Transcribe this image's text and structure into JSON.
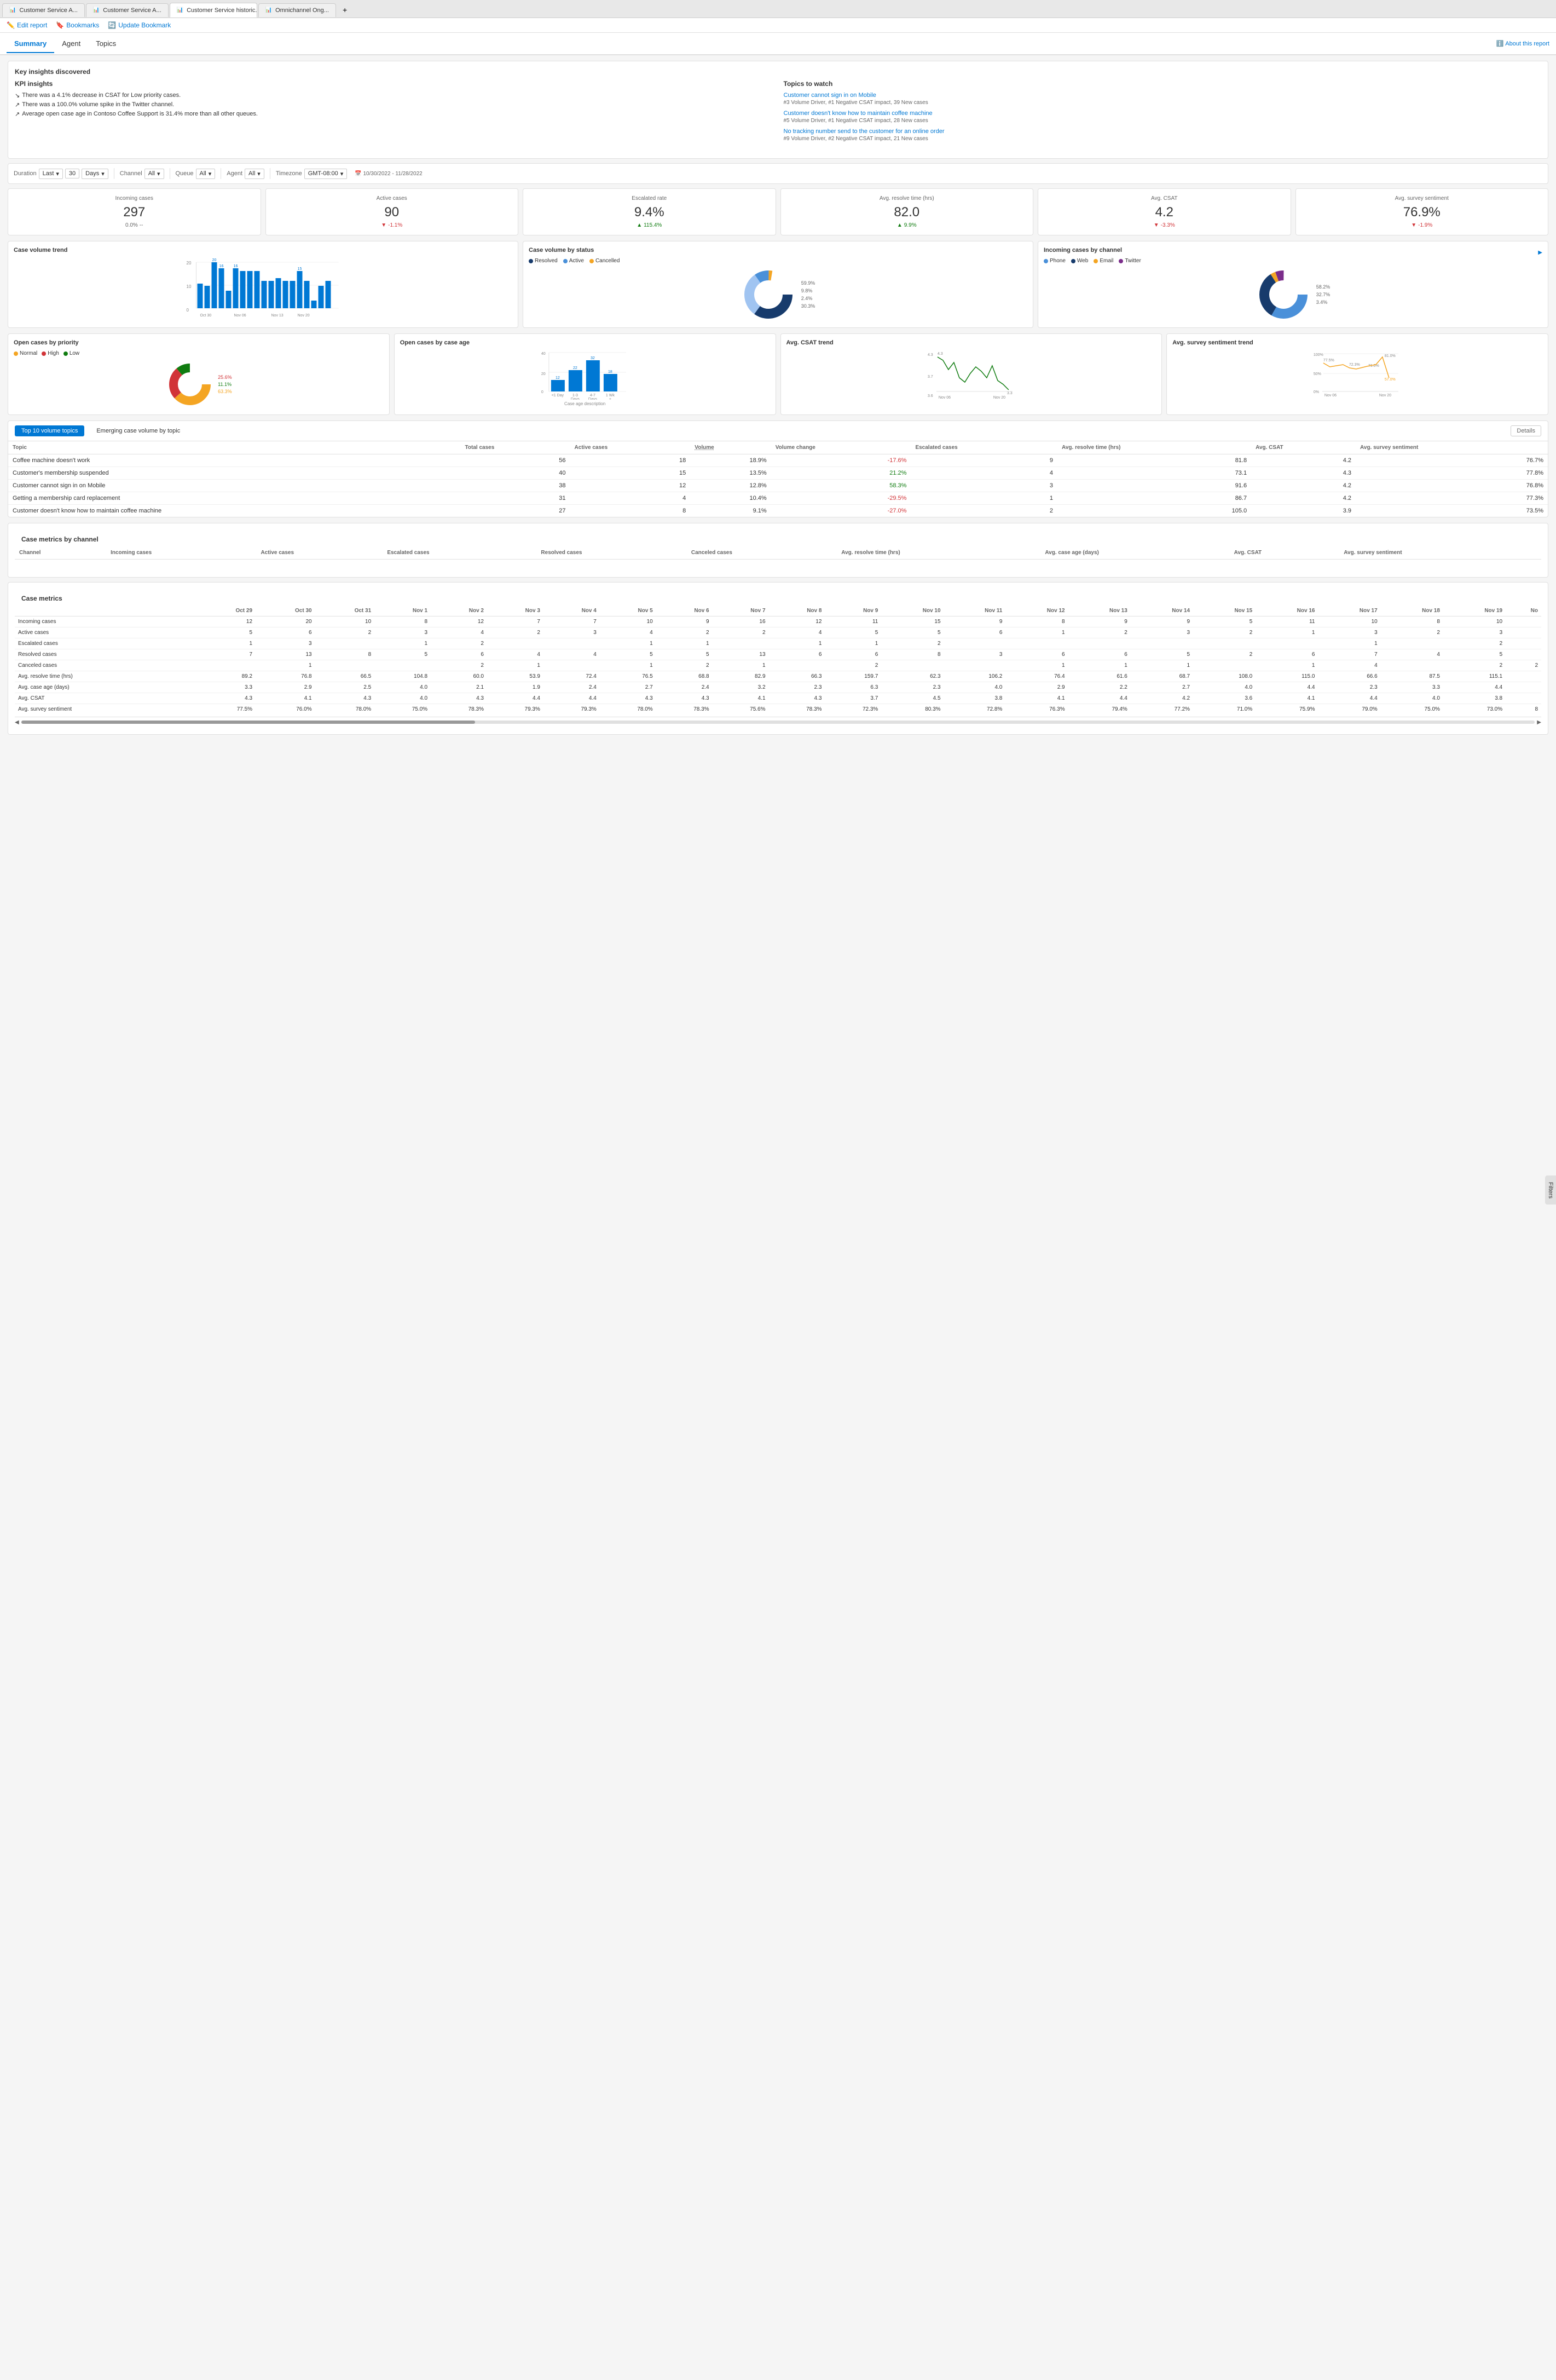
{
  "browser": {
    "tabs": [
      {
        "label": "Customer Service A...",
        "icon": "📊",
        "active": false
      },
      {
        "label": "Customer Service A...",
        "icon": "📊",
        "active": false
      },
      {
        "label": "Customer Service historic...",
        "icon": "📊",
        "active": true
      },
      {
        "label": "Omnichannel Ong...",
        "icon": "📊",
        "active": false
      }
    ]
  },
  "toolbar": {
    "edit_report": "Edit report",
    "bookmarks": "Bookmarks",
    "update_bookmark": "Update Bookmark"
  },
  "nav": {
    "tabs": [
      "Summary",
      "Agent",
      "Topics"
    ],
    "active": "Summary",
    "about_link": "About this report"
  },
  "insights": {
    "key_insights_title": "Key insights discovered",
    "kpi_title": "KPI insights",
    "kpi_items": [
      "There was a 4.1% decrease in CSAT for Low priority cases.",
      "There was a 100.0% volume spike in the Twitter channel.",
      "Average open case age in Contoso Coffee Support is 31.4% more than all other queues."
    ],
    "topics_title": "Topics to watch",
    "topics": [
      {
        "link": "Customer cannot sign in on Mobile",
        "meta": "#3 Volume Driver, #1 Negative CSAT impact, 39 New cases"
      },
      {
        "link": "Customer doesn't know how to maintain coffee machine",
        "meta": "#5 Volume Driver, #1 Negative CSAT impact, 28 New cases"
      },
      {
        "link": "No tracking number send to the customer for an online order",
        "meta": "#9 Volume Driver, #2 Negative CSAT impact, 21 New cases"
      }
    ]
  },
  "filters": {
    "duration_label": "Duration",
    "duration_type": "Last",
    "duration_value": "30",
    "duration_unit": "Days",
    "channel_label": "Channel",
    "channel_value": "All",
    "queue_label": "Queue",
    "queue_value": "All",
    "agent_label": "Agent",
    "agent_value": "All",
    "timezone_label": "Timezone",
    "timezone_value": "GMT-08:00",
    "date_range": "10/30/2022 - 11/28/2022"
  },
  "metrics": [
    {
      "label": "Incoming cases",
      "value": "297",
      "change": "0.0%",
      "change_dir": "neutral",
      "change2": "--"
    },
    {
      "label": "Active cases",
      "value": "90",
      "change": "-1.1%",
      "change_dir": "down"
    },
    {
      "label": "Escalated rate",
      "value": "9.4%",
      "change": "115.4%",
      "change_dir": "up"
    },
    {
      "label": "Avg. resolve time (hrs)",
      "value": "82.0",
      "change": "9.9%",
      "change_dir": "up"
    },
    {
      "label": "Avg. CSAT",
      "value": "4.2",
      "change": "-3.3%",
      "change_dir": "down"
    },
    {
      "label": "Avg. survey sentiment",
      "value": "76.9%",
      "change": "-1.9%",
      "change_dir": "down"
    }
  ],
  "case_volume_trend": {
    "title": "Case volume trend",
    "y_max": 20,
    "bars": [
      {
        "date": "Oct 30",
        "value": 12,
        "show_label": true
      },
      {
        "date": "",
        "value": 9,
        "show_label": false
      },
      {
        "date": "",
        "value": 20,
        "show_label": true,
        "highlight": true
      },
      {
        "date": "",
        "value": 16,
        "show_label": false
      },
      {
        "date": "",
        "value": 7,
        "show_label": false
      },
      {
        "date": "Nov 06",
        "value": 16,
        "show_label": true
      },
      {
        "date": "",
        "value": 14,
        "show_label": false
      },
      {
        "date": "",
        "value": 15,
        "show_label": false
      },
      {
        "date": "",
        "value": 15,
        "show_label": false
      },
      {
        "date": "",
        "value": 10,
        "show_label": false
      },
      {
        "date": "Nov 13",
        "value": 11,
        "show_label": false
      },
      {
        "date": "",
        "value": 12,
        "show_label": false
      },
      {
        "date": "",
        "value": 14,
        "show_label": false
      },
      {
        "date": "",
        "value": 13,
        "show_label": false
      },
      {
        "date": "",
        "value": 11,
        "show_label": false
      },
      {
        "date": "Nov 20",
        "value": 15,
        "show_label": true
      },
      {
        "date": "",
        "value": 10,
        "show_label": false
      },
      {
        "date": "",
        "value": 3,
        "show_label": false
      },
      {
        "date": "",
        "value": 9,
        "show_label": false
      },
      {
        "date": "",
        "value": 12,
        "show_label": false
      }
    ]
  },
  "case_volume_status": {
    "title": "Case volume by status",
    "legend": [
      {
        "label": "Resolved",
        "color": "#173b6c"
      },
      {
        "label": "Active",
        "color": "#4a90d9"
      },
      {
        "label": "Cancelled",
        "color": "#f4a523"
      }
    ],
    "segments": [
      {
        "label": "59.9%",
        "color": "#173b6c",
        "pct": 59.9
      },
      {
        "label": "9.8%",
        "color": "#4a90d9",
        "pct": 9.8
      },
      {
        "label": "2.4%",
        "color": "#f4a523",
        "pct": 2.4
      },
      {
        "label": "30.3%",
        "color": "#a0c4f1",
        "pct": 30.3
      }
    ]
  },
  "incoming_by_channel": {
    "title": "Incoming cases by channel",
    "legend": [
      {
        "label": "Phone",
        "color": "#4a90d9"
      },
      {
        "label": "Web",
        "color": "#173b6c"
      },
      {
        "label": "Email",
        "color": "#f4a523"
      },
      {
        "label": "Twitter",
        "color": "#7b2d8b"
      }
    ],
    "segments": [
      {
        "label": "58.2%",
        "color": "#4a90d9",
        "pct": 58.2
      },
      {
        "label": "32.7%",
        "color": "#173b6c",
        "pct": 32.7
      },
      {
        "label": "3.4%",
        "color": "#f4a523",
        "pct": 3.4
      },
      {
        "label": "5.7%",
        "color": "#7b2d8b",
        "pct": 5.7
      }
    ]
  },
  "open_cases_priority": {
    "title": "Open cases by priority",
    "legend": [
      {
        "label": "Normal",
        "color": "#f4a523"
      },
      {
        "label": "High",
        "color": "#d13438"
      },
      {
        "label": "Low",
        "color": "#107c10"
      }
    ],
    "segments": [
      {
        "pct": 63.3,
        "color": "#f4a523",
        "label": "63.3%"
      },
      {
        "pct": 25.6,
        "color": "#d13438",
        "label": "25.6%"
      },
      {
        "pct": 11.1,
        "color": "#107c10",
        "label": "11.1%"
      }
    ]
  },
  "open_cases_age": {
    "title": "Open cases by case age",
    "bars": [
      {
        "label": "<1 Day",
        "value": 12
      },
      {
        "label": "1-3 Days",
        "value": 22
      },
      {
        "label": "4-7 Days",
        "value": 32
      },
      {
        "label": "1 Week - 1 M...",
        "value": 18
      }
    ],
    "y_max": 40
  },
  "avg_csat_trend": {
    "title": "Avg. CSAT trend",
    "points": [
      4.3,
      4.2,
      3.9,
      4.1,
      3.7,
      3.6,
      3.8,
      4.0,
      3.9,
      3.7,
      4.1,
      3.5,
      3.6,
      3.3
    ],
    "labels": [
      "Nov 06",
      "Nov 20"
    ],
    "annotations": [
      "4.3",
      "3.7",
      "3.6",
      "3.3"
    ]
  },
  "avg_survey_trend": {
    "title": "Avg. survey sentiment trend",
    "points": [
      77.5,
      72.3,
      74.1,
      73.0,
      72.3,
      71.0,
      72.2,
      75.0,
      72.3,
      71.0,
      73.3,
      75.0,
      81.0,
      57.0
    ],
    "labels": [
      "Nov 06",
      "Nov 20"
    ],
    "annotations": [
      "77.5%",
      "72.3%",
      "71.0%",
      "81.0%",
      "57.0%"
    ],
    "y_labels": [
      "100%",
      "50%",
      "0%"
    ]
  },
  "topics_table": {
    "title": "Top 10 volume topics",
    "emerging_btn": "Emerging case volume by topic",
    "details_btn": "Details",
    "columns": [
      "Topic",
      "Total cases",
      "Active cases",
      "Volume",
      "Volume change",
      "Escalated cases",
      "Avg. resolve time (hrs)",
      "Avg. CSAT",
      "Avg. survey sentiment"
    ],
    "rows": [
      {
        "topic": "Coffee machine doesn't work",
        "total": 56,
        "active": 18,
        "volume": "18.9%",
        "vol_change": "-17.6%",
        "escalated": 9,
        "resolve": "81.8",
        "csat": "4.2",
        "sentiment": "76.7%"
      },
      {
        "topic": "Customer's membership suspended",
        "total": 40,
        "active": 15,
        "volume": "13.5%",
        "vol_change": "21.2%",
        "escalated": 4,
        "resolve": "73.1",
        "csat": "4.3",
        "sentiment": "77.8%"
      },
      {
        "topic": "Customer cannot sign in on Mobile",
        "total": 38,
        "active": 12,
        "volume": "12.8%",
        "vol_change": "58.3%",
        "escalated": 3,
        "resolve": "91.6",
        "csat": "4.2",
        "sentiment": "76.8%"
      },
      {
        "topic": "Getting a membership card replacement",
        "total": 31,
        "active": 4,
        "volume": "10.4%",
        "vol_change": "-29.5%",
        "escalated": 1,
        "resolve": "86.7",
        "csat": "4.2",
        "sentiment": "77.3%"
      },
      {
        "topic": "Customer doesn't know how to maintain coffee machine",
        "total": 27,
        "active": 8,
        "volume": "9.1%",
        "vol_change": "-27.0%",
        "escalated": 2,
        "resolve": "105.0",
        "csat": "3.9",
        "sentiment": "73.5%"
      }
    ]
  },
  "case_metrics_channel": {
    "title": "Case metrics by channel",
    "columns": [
      "Channel",
      "Incoming cases",
      "Active cases",
      "Escalated cases",
      "Resolved cases",
      "Canceled cases",
      "Avg. resolve time (hrs)",
      "Avg. case age (days)",
      "Avg. CSAT",
      "Avg. survey sentiment"
    ]
  },
  "case_metrics_daily": {
    "title": "Case metrics",
    "date_cols": [
      "Oct 29",
      "Oct 30",
      "Oct 31",
      "Nov 1",
      "Nov 2",
      "Nov 3",
      "Nov 4",
      "Nov 5",
      "Nov 6",
      "Nov 7",
      "Nov 8",
      "Nov 9",
      "Nov 10",
      "Nov 11",
      "Nov 12",
      "Nov 13",
      "Nov 14",
      "Nov 15",
      "Nov 16",
      "Nov 17",
      "Nov 18",
      "Nov 19",
      "No"
    ],
    "rows": [
      {
        "metric": "Incoming cases",
        "values": [
          12,
          20,
          10,
          8,
          12,
          7,
          7,
          10,
          9,
          16,
          12,
          11,
          15,
          9,
          8,
          9,
          9,
          5,
          11,
          10,
          8,
          10,
          ""
        ]
      },
      {
        "metric": "Active cases",
        "values": [
          5,
          6,
          2,
          3,
          4,
          2,
          3,
          4,
          2,
          2,
          4,
          5,
          5,
          6,
          1,
          2,
          3,
          2,
          1,
          3,
          2,
          3,
          ""
        ]
      },
      {
        "metric": "Escalated cases",
        "values": [
          1,
          3,
          "",
          1,
          2,
          "",
          "",
          1,
          1,
          "",
          1,
          1,
          2,
          "",
          "",
          "",
          "",
          "",
          "",
          1,
          "",
          2,
          ""
        ]
      },
      {
        "metric": "Resolved cases",
        "values": [
          7,
          13,
          8,
          5,
          6,
          4,
          4,
          5,
          5,
          13,
          6,
          6,
          8,
          3,
          6,
          6,
          5,
          2,
          6,
          7,
          4,
          5,
          ""
        ]
      },
      {
        "metric": "Canceled cases",
        "values": [
          "",
          1,
          "",
          "",
          2,
          1,
          "",
          1,
          2,
          1,
          "",
          2,
          "",
          "",
          1,
          1,
          1,
          "",
          1,
          4,
          "",
          2,
          2
        ]
      },
      {
        "metric": "Avg. resolve time (hrs)",
        "values": [
          "89.2",
          "76.8",
          "66.5",
          "104.8",
          "60.0",
          "53.9",
          "72.4",
          "76.5",
          "68.8",
          "82.9",
          "66.3",
          "159.7",
          "62.3",
          "106.2",
          "76.4",
          "61.6",
          "68.7",
          "108.0",
          "115.0",
          "66.6",
          "87.5",
          "115.1",
          ""
        ]
      },
      {
        "metric": "Avg. case age (days)",
        "values": [
          "3.3",
          "2.9",
          "2.5",
          "4.0",
          "2.1",
          "1.9",
          "2.4",
          "2.7",
          "2.4",
          "3.2",
          "2.3",
          "6.3",
          "2.3",
          "4.0",
          "2.9",
          "2.2",
          "2.7",
          "4.0",
          "4.4",
          "2.3",
          "3.3",
          "4.4",
          ""
        ]
      },
      {
        "metric": "Avg. CSAT",
        "values": [
          "4.3",
          "4.1",
          "4.3",
          "4.0",
          "4.3",
          "4.4",
          "4.4",
          "4.3",
          "4.3",
          "4.1",
          "4.3",
          "3.7",
          "4.5",
          "3.8",
          "4.1",
          "4.4",
          "4.2",
          "3.6",
          "4.1",
          "4.4",
          "4.0",
          "3.8",
          ""
        ]
      },
      {
        "metric": "Avg. survey sentiment",
        "values": [
          "77.5%",
          "76.0%",
          "78.0%",
          "75.0%",
          "78.3%",
          "79.3%",
          "79.3%",
          "78.0%",
          "78.3%",
          "75.6%",
          "78.3%",
          "72.3%",
          "80.3%",
          "72.8%",
          "76.3%",
          "79.4%",
          "77.2%",
          "71.0%",
          "75.9%",
          "79.0%",
          "75.0%",
          "73.0%",
          "8"
        ]
      }
    ]
  },
  "side_filter": "Filters",
  "colors": {
    "blue": "#0078d4",
    "dark_blue": "#173b6c",
    "light_blue": "#4a90d9",
    "orange": "#f4a523",
    "green": "#107c10",
    "red": "#d13438",
    "purple": "#7b2d8b"
  }
}
